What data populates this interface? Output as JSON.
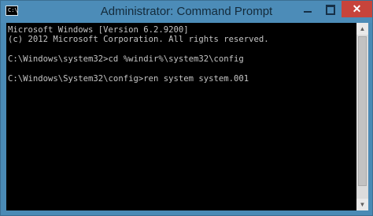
{
  "window": {
    "title": "Administrator: Command Prompt",
    "icon": "cmd-icon",
    "icon_glyph": "C:\\",
    "minimize_icon": "minimize-icon",
    "maximize_icon": "maximize-icon",
    "close_icon": "close-icon",
    "close_glyph": "✕",
    "accent_color": "#4c8cb8",
    "close_color": "#c7443b"
  },
  "console": {
    "lines": [
      "Microsoft Windows [Version 6.2.9200]",
      "(c) 2012 Microsoft Corporation. All rights reserved.",
      "",
      "C:\\Windows\\system32>cd %windir%\\system32\\config",
      "",
      "C:\\Windows\\System32\\config>ren system system.001"
    ]
  },
  "scrollbar": {
    "up_glyph": "▲",
    "down_glyph": "▼"
  }
}
